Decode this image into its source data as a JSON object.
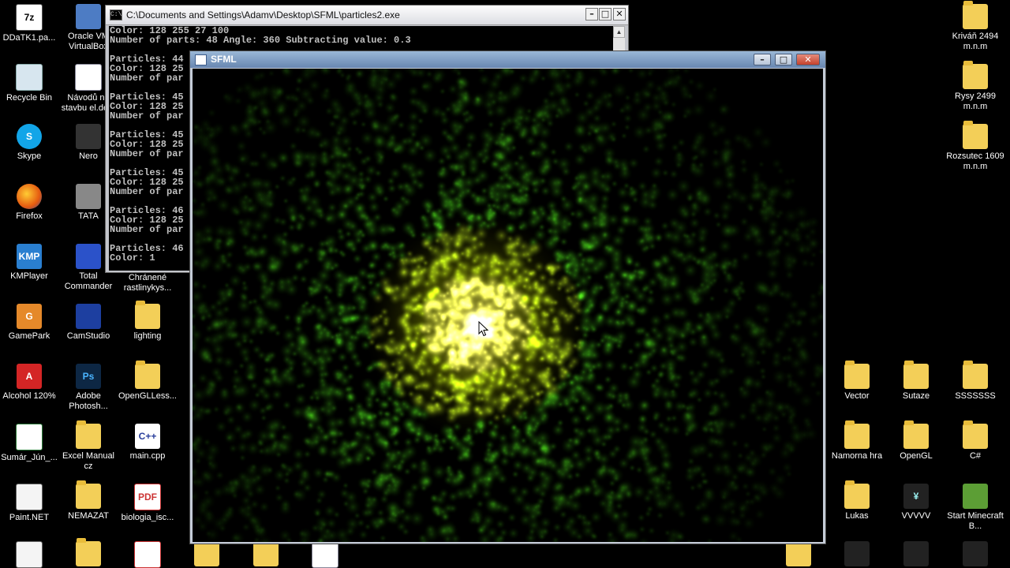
{
  "desktop": {
    "left_icons": [
      {
        "label": "DDaTK1.pa...",
        "icon": "text-file-icon"
      },
      {
        "label": "Recycle Bin",
        "icon": "recycle-bin-icon"
      },
      {
        "label": "Skype",
        "icon": "skype-icon"
      },
      {
        "label": "Firefox",
        "icon": "firefox-icon"
      },
      {
        "label": "KMPlayer",
        "icon": "kmplayer-icon"
      },
      {
        "label": "GamePark",
        "icon": "gamepark-icon"
      },
      {
        "label": "Alcohol 120%",
        "icon": "alcohol-icon"
      },
      {
        "label": "Sumár_Jún_...",
        "icon": "excel-file-icon"
      },
      {
        "label": "Paint.NET",
        "icon": "paint-net-icon"
      },
      {
        "label": "Oracle VM VirtualBox",
        "icon": "virtualbox-icon"
      },
      {
        "label": "Návodů na stavbu el.de...",
        "icon": "document-icon"
      },
      {
        "label": "Nero",
        "icon": "nero-icon"
      },
      {
        "label": "TATA",
        "icon": "camera-icon"
      },
      {
        "label": "Total Commander",
        "icon": "total-commander-icon"
      },
      {
        "label": "CamStudio",
        "icon": "camstudio-icon"
      },
      {
        "label": "Adobe Photosh...",
        "icon": "photoshop-icon"
      },
      {
        "label": "Excel Manual cz",
        "icon": "folder-icon"
      },
      {
        "label": "NEMAZAT",
        "icon": "folder-icon"
      },
      {
        "label": "Chránené rastlinykys...",
        "icon": "document-icon"
      },
      {
        "label": "lighting",
        "icon": "folder-icon"
      },
      {
        "label": "OpenGLLess...",
        "icon": "folder-icon"
      },
      {
        "label": "main.cpp",
        "icon": "cpp-file-icon"
      },
      {
        "label": "biologia_isc...",
        "icon": "pdf-icon"
      }
    ],
    "right_icons": [
      {
        "label": "Kriváň 2494 m.n.m",
        "icon": "folder-icon"
      },
      {
        "label": "Rysy 2499 m.n.m",
        "icon": "folder-icon"
      },
      {
        "label": "Rozsutec 1609 m.n.m",
        "icon": "folder-icon"
      },
      {
        "label": "Vector",
        "icon": "folder-icon"
      },
      {
        "label": "Sutaze",
        "icon": "folder-icon"
      },
      {
        "label": "SSSSSSS",
        "icon": "folder-icon"
      },
      {
        "label": "Namorna hra",
        "icon": "folder-icon"
      },
      {
        "label": "OpenGL",
        "icon": "folder-icon"
      },
      {
        "label": "C#",
        "icon": "folder-icon"
      },
      {
        "label": "Lukas",
        "icon": "folder-icon"
      },
      {
        "label": "VVVVV",
        "icon": "app-icon"
      },
      {
        "label": "Start Minecraft B...",
        "icon": "minecraft-icon"
      }
    ]
  },
  "console": {
    "title": "C:\\Documents and Settings\\Adamv\\Desktop\\SFML\\particles2.exe",
    "lines": [
      "Color: 128 255 27 100",
      "Number of parts: 48 Angle: 360 Subtracting value: 0.3",
      "",
      "Particles: 44",
      "Color: 128 25",
      "Number of par",
      "",
      "Particles: 45",
      "Color: 128 25",
      "Number of par",
      "",
      "Particles: 45",
      "Color: 128 25",
      "Number of par",
      "",
      "Particles: 45",
      "Color: 128 25",
      "Number of par",
      "",
      "Particles: 46",
      "Color: 128 25",
      "Number of par",
      "",
      "Particles: 46",
      "Color: 1"
    ]
  },
  "sfml": {
    "title": "SFML"
  },
  "window_buttons": {
    "minimize": "–",
    "maximize": "□",
    "close": "✕"
  },
  "colors": {
    "particle_core": "#ffffff",
    "particle_mid": "#f5ef00",
    "particle_outer": "#6fd11a",
    "particle_edge": "#1e5a08"
  }
}
